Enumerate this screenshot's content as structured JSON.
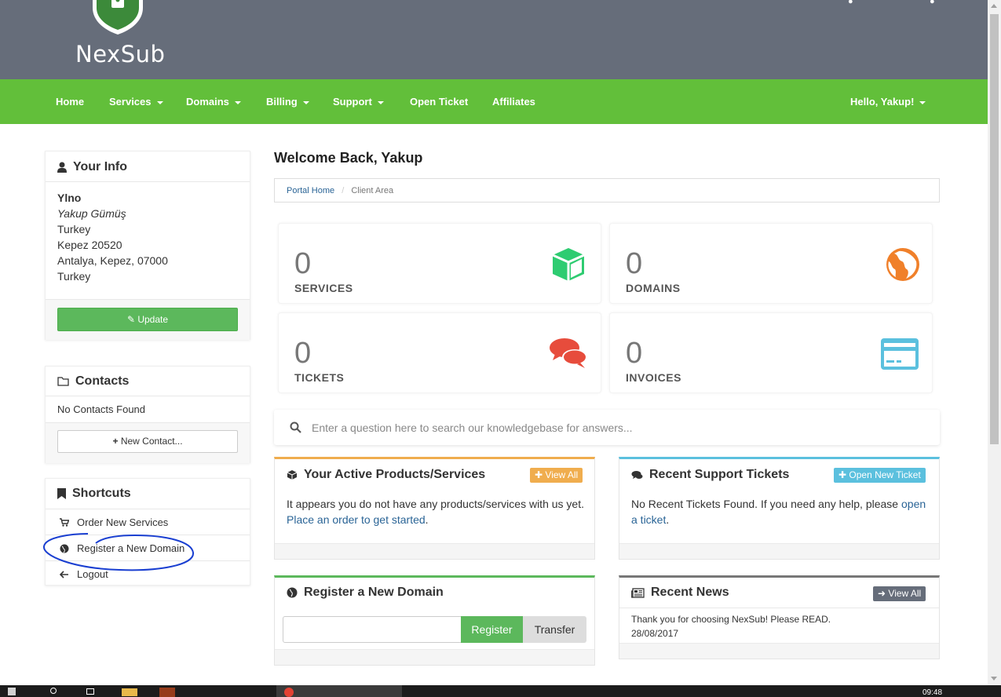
{
  "header": {
    "brand": "NexSub"
  },
  "nav": {
    "items": [
      {
        "label": "Home",
        "dropdown": false
      },
      {
        "label": "Services",
        "dropdown": true
      },
      {
        "label": "Domains",
        "dropdown": true
      },
      {
        "label": "Billing",
        "dropdown": true
      },
      {
        "label": "Support",
        "dropdown": true
      },
      {
        "label": "Open Ticket",
        "dropdown": false
      },
      {
        "label": "Affiliates",
        "dropdown": false
      }
    ],
    "user_label": "Hello, Yakup!"
  },
  "your_info": {
    "title": "Your Info",
    "lines": [
      "Ylno",
      "Yakup Gümüş",
      "Turkey",
      "Kepez 20520",
      "Antalya, Kepez, 07000",
      "Turkey"
    ],
    "update_label": "Update"
  },
  "contacts": {
    "title": "Contacts",
    "empty_text": "No Contacts Found",
    "new_contact_label": "New Contact..."
  },
  "shortcuts": {
    "title": "Shortcuts",
    "items": [
      {
        "label": "Order New Services",
        "icon": "cart-icon"
      },
      {
        "label": "Register a New Domain",
        "icon": "globe-icon"
      },
      {
        "label": "Logout",
        "icon": "arrow-left-icon"
      }
    ]
  },
  "main": {
    "welcome": "Welcome Back, Yakup",
    "breadcrumb": {
      "home": "Portal Home",
      "separator": "/",
      "current": "Client Area"
    },
    "tiles": [
      {
        "count": "0",
        "label": "SERVICES",
        "icon": "cube-icon",
        "color": "#2ecc71"
      },
      {
        "count": "0",
        "label": "DOMAINS",
        "icon": "globe-icon",
        "color": "#f0802a"
      },
      {
        "count": "0",
        "label": "TICKETS",
        "icon": "comments-icon",
        "color": "#e74c3c"
      },
      {
        "count": "0",
        "label": "INVOICES",
        "icon": "credit-card-icon",
        "color": "#5bc0de"
      }
    ],
    "kb_placeholder": "Enter a question here to search our knowledgebase for answers...",
    "products": {
      "title": "Your Active Products/Services",
      "view_all": "View All",
      "text": "It appears you do not have any products/services with us yet.",
      "link": "Place an order to get started",
      "link_suffix": "."
    },
    "tickets": {
      "title": "Recent Support Tickets",
      "button": "Open New Ticket",
      "text": "No Recent Tickets Found. If you need any help, please",
      "link": "open a ticket",
      "link_suffix": "."
    },
    "register_domain": {
      "title": "Register a New Domain",
      "register_label": "Register",
      "transfer_label": "Transfer",
      "input_value": ""
    },
    "news": {
      "title": "Recent News",
      "view_all": "View All",
      "items": [
        {
          "text": "Thank you for choosing NexSub! Please READ.",
          "date": "28/08/2017"
        }
      ]
    }
  },
  "taskbar": {
    "clock": "09:48"
  },
  "colors": {
    "topbar": "#666d7a",
    "navbar": "#62bf3a",
    "products_accent": "#f0ad4e",
    "tickets_accent": "#5bc0de",
    "domain_accent": "#5cb85c",
    "news_accent": "#777777"
  }
}
